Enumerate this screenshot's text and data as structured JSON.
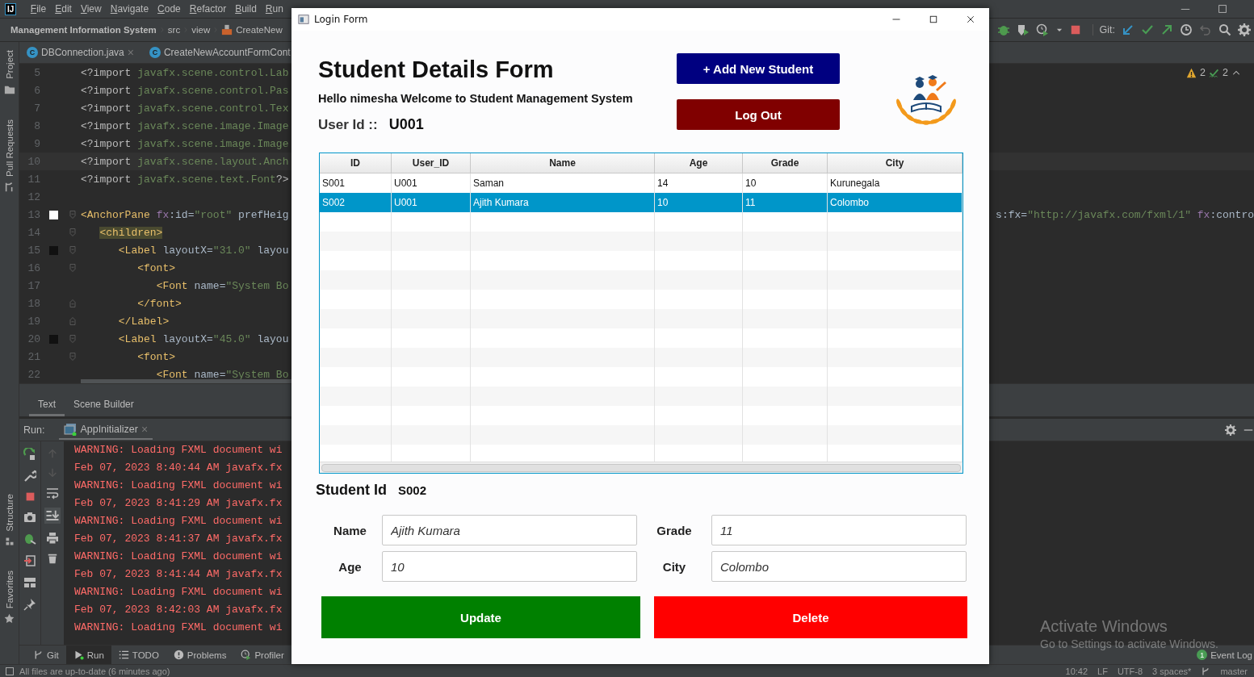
{
  "ide": {
    "app_badge": "IJ",
    "menu": [
      "File",
      "Edit",
      "View",
      "Navigate",
      "Code",
      "Refactor",
      "Build",
      "Run"
    ],
    "breadcrumb": [
      {
        "label": "Management Information System",
        "kind": "project"
      },
      {
        "label": "src",
        "kind": "folder"
      },
      {
        "label": "view",
        "kind": "folder"
      },
      {
        "label": "CreateNew",
        "kind": "file"
      }
    ],
    "git_label": "Git:",
    "side_tools_top": [
      "Project",
      "Pull Requests"
    ],
    "side_tools_bottom": [
      "Structure",
      "Favorites"
    ],
    "editor_tabs": [
      {
        "badge": "C",
        "label": "DBConnection.java",
        "close": "×"
      },
      {
        "badge": "C",
        "label": "CreateNewAccountFormCont"
      }
    ],
    "inspections": {
      "warnings": "2",
      "weak_warnings": "2"
    },
    "code_lines": [
      {
        "number": "5",
        "text": "<?import javafx.scene.control.Lab"
      },
      {
        "number": "6",
        "text": "<?import javafx.scene.control.Pas"
      },
      {
        "number": "7",
        "text": "<?import javafx.scene.control.Tex"
      },
      {
        "number": "8",
        "text": "<?import javafx.scene.image.Image"
      },
      {
        "number": "9",
        "text": "<?import javafx.scene.image.Image"
      },
      {
        "number": "10",
        "text": "<?import javafx.scene.layout.Anch",
        "current": true
      },
      {
        "number": "11",
        "text": "<?import javafx.scene.text.Font?>"
      },
      {
        "number": "12"
      },
      {
        "number": "13",
        "text": "<AnchorPane fx:id=\"root\" prefHeig",
        "right_text": "s:fx=\"http://javafx.com/fxml/1\" fx:contro",
        "color": "#ffffff",
        "fold_start": true
      },
      {
        "number": "14",
        "text": "   <children>",
        "matched": true,
        "fold_start": true
      },
      {
        "number": "15",
        "text": "      <Label layoutX=\"31.0\" layou",
        "color": "#111111",
        "fold_start": true
      },
      {
        "number": "16",
        "text": "         <font>",
        "fold_start": true
      },
      {
        "number": "17",
        "text": "            <Font name=\"System Bo"
      },
      {
        "number": "18",
        "text": "         </font>",
        "fold_end": true
      },
      {
        "number": "19",
        "text": "      </Label>",
        "fold_end": true
      },
      {
        "number": "20",
        "text": "      <Label layoutX=\"45.0\" layou",
        "color": "#111111",
        "fold_start": true
      },
      {
        "number": "21",
        "text": "         <font>",
        "fold_start": true
      },
      {
        "number": "22",
        "text": "            <Font name=\"System Bo"
      }
    ],
    "design_tabs": [
      {
        "label": "Text",
        "selected": true
      },
      {
        "label": "Scene Builder",
        "selected": false
      }
    ],
    "run_label": "Run:",
    "run_tab": {
      "label": "AppInitializer",
      "close": "×"
    },
    "console_lines": [
      "WARNING: Loading FXML document wi",
      "Feb 07, 2023 8:40:44 AM javafx.fx",
      "WARNING: Loading FXML document wi",
      "Feb 07, 2023 8:41:29 AM javafx.fx",
      "WARNING: Loading FXML document wi",
      "Feb 07, 2023 8:41:37 AM javafx.fx",
      "WARNING: Loading FXML document wi",
      "Feb 07, 2023 8:41:44 AM javafx.fx",
      "WARNING: Loading FXML document wi",
      "Feb 07, 2023 8:42:03 AM javafx.fx",
      "WARNING: Loading FXML document wi"
    ],
    "tool_tabs": [
      {
        "label": "Git",
        "kind": "git",
        "selected": false
      },
      {
        "label": "Run",
        "kind": "run",
        "selected": true
      },
      {
        "label": "TODO",
        "kind": "todo",
        "selected": false
      },
      {
        "label": "Problems",
        "kind": "problems",
        "selected": false
      },
      {
        "label": "Profiler",
        "kind": "profiler",
        "selected": false
      }
    ],
    "event_log": {
      "count": "1",
      "label": "Event Log"
    },
    "status_left": "All files are up-to-date (6 minutes ago)",
    "status_right": [
      "10:42",
      "LF",
      "UTF-8",
      "3 spaces*"
    ],
    "branch": "master"
  },
  "form_window": {
    "title": "Login Form",
    "heading": "Student Details Form",
    "greeting": "Hello nimesha Welcome to Student Management System",
    "user_id_label": "User Id ::",
    "user_id": "U001",
    "buttons": [
      {
        "label": "+ Add New Student",
        "kind": "add"
      },
      {
        "label": "Log Out",
        "kind": "logout"
      }
    ],
    "table": {
      "columns": [
        "ID",
        "User_ID",
        "Name",
        "Age",
        "Grade",
        "City"
      ],
      "rows": [
        {
          "cells": [
            "S001",
            "U001",
            "Saman",
            "14",
            "10",
            "Kurunegala"
          ],
          "selected": false
        },
        {
          "cells": [
            "S002",
            "U001",
            "Ajith Kumara",
            "10",
            "11",
            "Colombo"
          ],
          "selected": true
        }
      ]
    },
    "student_id_label": "Student Id",
    "student_id": "S002",
    "fields": [
      {
        "label": "Name",
        "value": "Ajith Kumara"
      },
      {
        "label": "Grade",
        "value": "11"
      },
      {
        "label": "Age",
        "value": "10"
      },
      {
        "label": "City",
        "value": "Colombo"
      }
    ],
    "actions": [
      {
        "label": "Update",
        "kind": "update"
      },
      {
        "label": "Delete",
        "kind": "delete"
      }
    ]
  },
  "activation_notice": {
    "title": "Activate Windows",
    "hint": "Go to Settings to activate Windows."
  }
}
